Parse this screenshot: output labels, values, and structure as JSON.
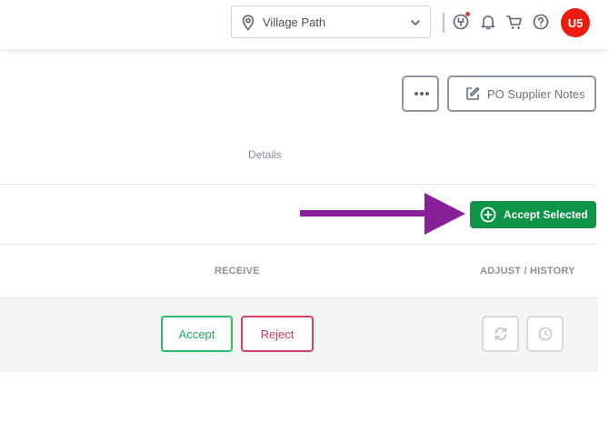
{
  "header": {
    "location": {
      "value": "Village Path"
    },
    "icons": [
      "location-pin-icon",
      "chevron-down-icon",
      "headset-icon",
      "bell-icon",
      "cart-icon",
      "help-icon"
    ],
    "notification_dot_color": "#e33c46",
    "user": {
      "initials": "U5",
      "avatar_color": "#ee1b11"
    }
  },
  "toolbar": {
    "more_icon": "ellipsis-icon",
    "notes_label": "PO Supplier Notes",
    "notes_icon": "edit-icon"
  },
  "section": {
    "details_label": "Details"
  },
  "bulk": {
    "accept_selected_label": "Accept Selected",
    "accept_selected_color": "#0d9446",
    "annotation": {
      "type": "arrow",
      "color": "#8a1f9a"
    }
  },
  "table": {
    "columns": {
      "receive": "RECEIVE",
      "adjust": "ADJUST / HISTORY"
    },
    "row": {
      "accept_label": "Accept",
      "reject_label": "Reject",
      "accept_color": "#2dbb6a",
      "reject_color": "#d43f63",
      "adjust_icon": "refresh-icon",
      "history_icon": "history-clock-icon"
    }
  }
}
